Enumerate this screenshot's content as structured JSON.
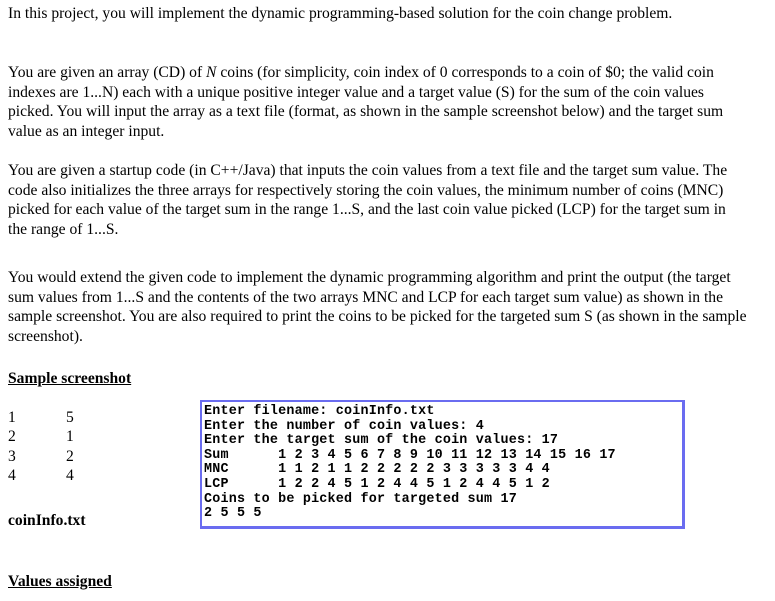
{
  "paragraphs": [
    "In this project, you will implement the dynamic programming-based solution for the coin change problem.",
    "You are given an array (CD) of N coins (for simplicity, coin index of 0 corresponds to a coin of $0; the valid coin indexes are 1...N) each with a unique positive integer value and a target value (S) for the sum of the coin values picked. You will input the array as a text file (format, as shown in the sample screenshot below) and the target sum value as an integer input.",
    "You are given a startup code (in C++/Java) that inputs the coin values from a text file and the target sum value. The code also initializes the three arrays for respectively storing the coin values, the minimum number of coins (MNC) picked for each value of the target sum in the range 1...S, and the last coin value picked (LCP) for the target sum in the range of 1...S.",
    "You would extend the given code to implement the dynamic programming algorithm and print the output (the target sum values from 1...S and the contents of the two arrays MNC and LCP for each target sum value) as shown in the sample screenshot. You are also required to print the coins to be picked for the targeted sum S (as shown in the sample screenshot)."
  ],
  "p2_parts": {
    "before_n": "You are given an array (CD) of ",
    "n": "N",
    "after_n": " coins (for simplicity, coin index of 0 corresponds to a coin of $0; the valid coin indexes are 1...N) each with a unique positive integer value and a target value (S) for the sum of the coin values picked. You will input the array as a text file (format, as shown in the sample screenshot below) and the target sum value as an integer input."
  },
  "headings": {
    "sample": "Sample screenshot",
    "values": "Values assigned"
  },
  "coin_file": {
    "name": "coinInfo.txt",
    "rows": [
      {
        "index": "1",
        "value": "5"
      },
      {
        "index": "2",
        "value": "1"
      },
      {
        "index": "3",
        "value": "2"
      },
      {
        "index": "4",
        "value": "4"
      }
    ]
  },
  "console": {
    "lines": [
      "Enter filename: coinInfo.txt",
      "Enter the number of coin values: 4",
      "Enter the target sum of the coin values: 17",
      "Sum      1 2 3 4 5 6 7 8 9 10 11 12 13 14 15 16 17",
      "MNC      1 1 2 1 1 2 2 2 2 2 3 3 3 3 3 4 4",
      "LCP      1 2 2 4 5 1 2 4 4 5 1 2 4 4 5 1 2",
      "Coins to be picked for targeted sum 17",
      "2 5 5 5"
    ],
    "border_color": "#6a6cf0"
  }
}
